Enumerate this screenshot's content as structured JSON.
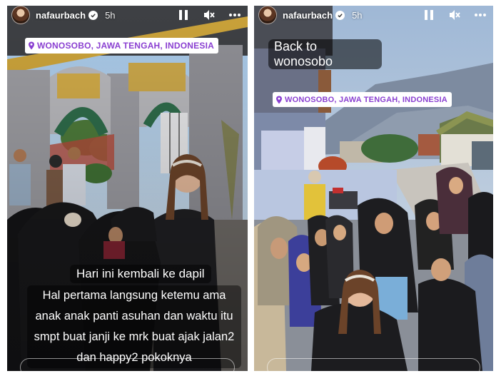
{
  "stories": [
    {
      "username": "nafaurbach",
      "time": "5h",
      "location": "WONOSOBO, JAWA TENGAH, INDONESIA",
      "caption_title": "Hari ini kembali ke dapil",
      "caption_body": "Hal pertama langsung ketemu ama anak anak panti asuhan dan waktu itu smpt buat janji ke mrk buat ajak jalan2 dan happy2 pokoknya"
    },
    {
      "username": "nafaurbach",
      "time": "5h",
      "location": "WONOSOBO, JAWA TENGAH, INDONESIA",
      "caption": "Back to wonosobo"
    }
  ],
  "icons": {
    "verified": "verified-badge-icon",
    "pause": "pause-icon",
    "mute": "speaker-muted-icon",
    "more": "more-options-icon",
    "pin": "location-pin-icon"
  },
  "colors": {
    "location_text": "#8a3fd1",
    "verified_badge": "#ffffff"
  }
}
